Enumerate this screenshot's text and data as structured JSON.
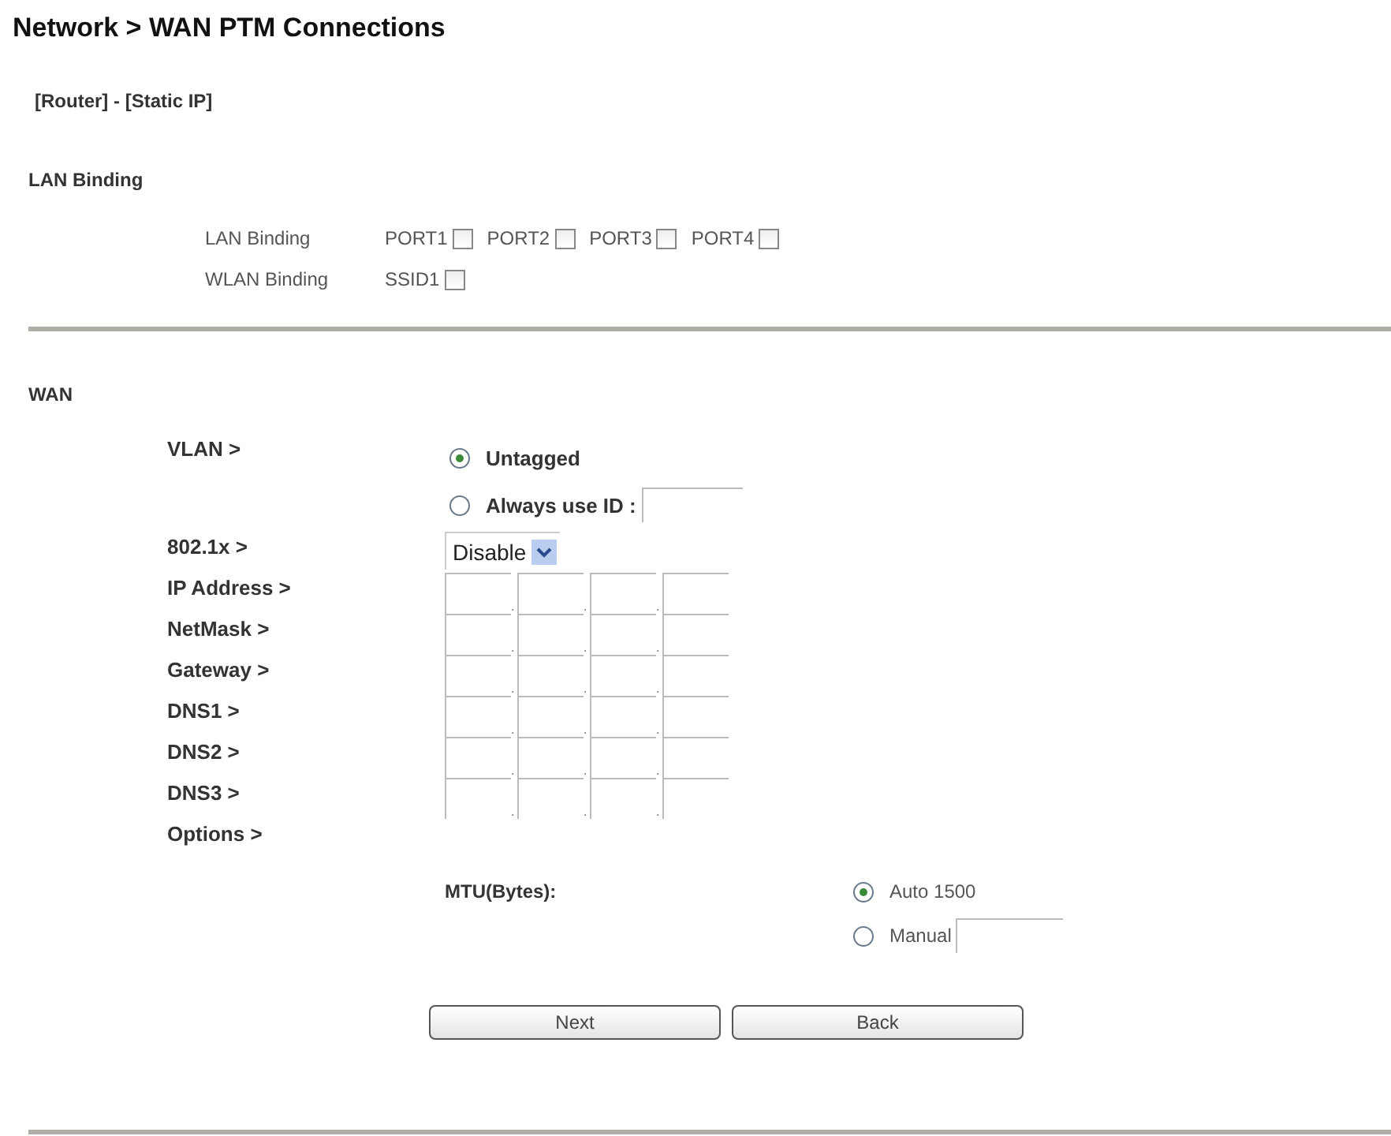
{
  "title": "Network > WAN PTM Connections",
  "mode": "[Router] - [Static IP]",
  "lan_binding": {
    "heading": "LAN Binding",
    "rows": [
      {
        "label": "LAN Binding",
        "options": [
          {
            "label": "PORT1",
            "checked": false
          },
          {
            "label": "PORT2",
            "checked": false
          },
          {
            "label": "PORT3",
            "checked": false
          },
          {
            "label": "PORT4",
            "checked": false
          }
        ]
      },
      {
        "label": "WLAN Binding",
        "options": [
          {
            "label": "SSID1",
            "checked": false
          }
        ]
      }
    ]
  },
  "wan": {
    "heading": "WAN",
    "vlan": {
      "label": "VLAN >",
      "options": [
        {
          "label": "Untagged",
          "selected": true,
          "kind": "plain"
        },
        {
          "label": "Always use ID :",
          "selected": false,
          "kind": "entry"
        }
      ]
    },
    "dot1x": {
      "label": "802.1x >",
      "value": "Disable"
    },
    "ip_separator": ".",
    "ip_rows": [
      {
        "label": "IP Address >"
      },
      {
        "label": "NetMask >"
      },
      {
        "label": "Gateway >"
      },
      {
        "label": "DNS1 >"
      },
      {
        "label": "DNS2 >"
      },
      {
        "label": "DNS3 >"
      }
    ],
    "options_label": "Options >",
    "mtu": {
      "label": "MTU(Bytes):",
      "options": [
        {
          "label": "Auto 1500",
          "selected": true,
          "kind": "plain"
        },
        {
          "label": "Manual",
          "selected": false,
          "kind": "entry"
        }
      ]
    }
  },
  "buttons": [
    "Next",
    "Back"
  ]
}
